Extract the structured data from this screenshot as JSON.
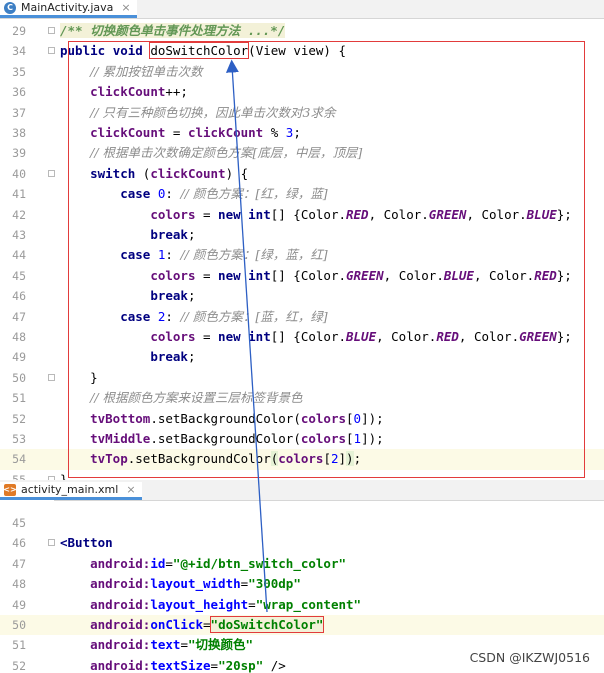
{
  "tabs": {
    "java_file": "MainActivity.java",
    "xml_file": "activity_main.xml"
  },
  "editor1": {
    "lines": [
      {
        "n": "29",
        "parts": [
          [
            "doc",
            "/** 切换颜色单击事件处理方法 ...*/"
          ]
        ]
      },
      {
        "n": "34",
        "parts": [
          [
            "kw",
            "public "
          ],
          [
            "kw",
            "void "
          ],
          [
            "box",
            "doSwitchColor"
          ],
          [
            "pl",
            "(View view) {"
          ]
        ]
      },
      {
        "n": "35",
        "parts": [
          [
            "pl",
            "    "
          ],
          [
            "cm",
            "// 累加按钮单击次数"
          ]
        ]
      },
      {
        "n": "36",
        "parts": [
          [
            "pl",
            "    "
          ],
          [
            "fld",
            "clickCount"
          ],
          [
            "pl",
            "++;"
          ]
        ]
      },
      {
        "n": "37",
        "parts": [
          [
            "pl",
            "    "
          ],
          [
            "cm",
            "// 只有三种颜色切换，因此单击次数对3求余"
          ]
        ]
      },
      {
        "n": "38",
        "parts": [
          [
            "pl",
            "    "
          ],
          [
            "fld",
            "clickCount"
          ],
          [
            "pl",
            " = "
          ],
          [
            "fld",
            "clickCount"
          ],
          [
            "pl",
            " % "
          ],
          [
            "num",
            "3"
          ],
          [
            "pl",
            ";"
          ]
        ]
      },
      {
        "n": "39",
        "parts": [
          [
            "pl",
            "    "
          ],
          [
            "cm",
            "// 根据单击次数确定颜色方案[底层，中层，顶层]"
          ]
        ]
      },
      {
        "n": "40",
        "parts": [
          [
            "pl",
            "    "
          ],
          [
            "kw",
            "switch"
          ],
          [
            "pl",
            " ("
          ],
          [
            "fld",
            "clickCount"
          ],
          [
            "pl",
            ") {"
          ]
        ]
      },
      {
        "n": "41",
        "parts": [
          [
            "pl",
            "        "
          ],
          [
            "kw",
            "case "
          ],
          [
            "num",
            "0"
          ],
          [
            "pl",
            ": "
          ],
          [
            "cm",
            "// 颜色方案：[红，绿，蓝]"
          ]
        ]
      },
      {
        "n": "42",
        "parts": [
          [
            "pl",
            "            "
          ],
          [
            "fld",
            "colors"
          ],
          [
            "pl",
            " = "
          ],
          [
            "kw",
            "new "
          ],
          [
            "kw",
            "int"
          ],
          [
            "pl",
            "[] {Color."
          ],
          [
            "cst",
            "RED"
          ],
          [
            "pl",
            ", Color."
          ],
          [
            "cst",
            "GREEN"
          ],
          [
            "pl",
            ", Color."
          ],
          [
            "cst",
            "BLUE"
          ],
          [
            "pl",
            "};"
          ]
        ]
      },
      {
        "n": "43",
        "parts": [
          [
            "pl",
            "            "
          ],
          [
            "kw",
            "break"
          ],
          [
            "pl",
            ";"
          ]
        ]
      },
      {
        "n": "44",
        "parts": [
          [
            "pl",
            "        "
          ],
          [
            "kw",
            "case "
          ],
          [
            "num",
            "1"
          ],
          [
            "pl",
            ": "
          ],
          [
            "cm",
            "// 颜色方案：[绿，蓝，红]"
          ]
        ]
      },
      {
        "n": "45",
        "parts": [
          [
            "pl",
            "            "
          ],
          [
            "fld",
            "colors"
          ],
          [
            "pl",
            " = "
          ],
          [
            "kw",
            "new "
          ],
          [
            "kw",
            "int"
          ],
          [
            "pl",
            "[] {Color."
          ],
          [
            "cst",
            "GREEN"
          ],
          [
            "pl",
            ", Color."
          ],
          [
            "cst",
            "BLUE"
          ],
          [
            "pl",
            ", Color."
          ],
          [
            "cst",
            "RED"
          ],
          [
            "pl",
            "};"
          ]
        ]
      },
      {
        "n": "46",
        "parts": [
          [
            "pl",
            "            "
          ],
          [
            "kw",
            "break"
          ],
          [
            "pl",
            ";"
          ]
        ]
      },
      {
        "n": "47",
        "parts": [
          [
            "pl",
            "        "
          ],
          [
            "kw",
            "case "
          ],
          [
            "num",
            "2"
          ],
          [
            "pl",
            ": "
          ],
          [
            "cm",
            "// 颜色方案：[蓝，红，绿]"
          ]
        ]
      },
      {
        "n": "48",
        "parts": [
          [
            "pl",
            "            "
          ],
          [
            "fld",
            "colors"
          ],
          [
            "pl",
            " = "
          ],
          [
            "kw",
            "new "
          ],
          [
            "kw",
            "int"
          ],
          [
            "pl",
            "[] {Color."
          ],
          [
            "cst",
            "BLUE"
          ],
          [
            "pl",
            ", Color."
          ],
          [
            "cst",
            "RED"
          ],
          [
            "pl",
            ", Color."
          ],
          [
            "cst",
            "GREEN"
          ],
          [
            "pl",
            "};"
          ]
        ]
      },
      {
        "n": "49",
        "parts": [
          [
            "pl",
            "            "
          ],
          [
            "kw",
            "break"
          ],
          [
            "pl",
            ";"
          ]
        ]
      },
      {
        "n": "50",
        "parts": [
          [
            "pl",
            "    }"
          ]
        ]
      },
      {
        "n": "51",
        "parts": [
          [
            "pl",
            "    "
          ],
          [
            "cm",
            "// 根据颜色方案来设置三层标签背景色"
          ]
        ]
      },
      {
        "n": "52",
        "parts": [
          [
            "pl",
            "    "
          ],
          [
            "fld",
            "tvBottom"
          ],
          [
            "pl",
            ".setBackgroundColor("
          ],
          [
            "fld",
            "colors"
          ],
          [
            "pl",
            "["
          ],
          [
            "num",
            "0"
          ],
          [
            "pl",
            "]);"
          ]
        ]
      },
      {
        "n": "53",
        "parts": [
          [
            "pl",
            "    "
          ],
          [
            "fld",
            "tvMiddle"
          ],
          [
            "pl",
            ".setBackgroundColor("
          ],
          [
            "fld",
            "colors"
          ],
          [
            "pl",
            "["
          ],
          [
            "num",
            "1"
          ],
          [
            "pl",
            "]);"
          ]
        ]
      },
      {
        "n": "54",
        "current": true,
        "parts": [
          [
            "pl",
            "    "
          ],
          [
            "fld",
            "tvTop"
          ],
          [
            "pl",
            ".setBackgroundColor"
          ],
          [
            "hl",
            "("
          ],
          [
            "fld",
            "colors"
          ],
          [
            "pl",
            "["
          ],
          [
            "num",
            "2"
          ],
          [
            "pl",
            "]"
          ],
          [
            "hl",
            ")"
          ],
          [
            "pl",
            ";"
          ]
        ]
      },
      {
        "n": "55",
        "parts": [
          [
            "pl",
            "}"
          ]
        ]
      }
    ]
  },
  "editor2": {
    "lines": [
      {
        "n": "45",
        "parts": []
      },
      {
        "n": "46",
        "parts": [
          [
            "tag",
            "<Button"
          ]
        ]
      },
      {
        "n": "47",
        "parts": [
          [
            "pl",
            "    "
          ],
          [
            "attrns",
            "android:"
          ],
          [
            "attr",
            "id"
          ],
          [
            "pl",
            "="
          ],
          [
            "str",
            "\"@+id/btn_switch_color\""
          ]
        ]
      },
      {
        "n": "48",
        "parts": [
          [
            "pl",
            "    "
          ],
          [
            "attrns",
            "android:"
          ],
          [
            "attr",
            "layout_width"
          ],
          [
            "pl",
            "="
          ],
          [
            "str",
            "\"300dp\""
          ]
        ]
      },
      {
        "n": "49",
        "parts": [
          [
            "pl",
            "    "
          ],
          [
            "attrns",
            "android:"
          ],
          [
            "attr",
            "layout_height"
          ],
          [
            "pl",
            "="
          ],
          [
            "str",
            "\"wrap_content\""
          ]
        ]
      },
      {
        "n": "50",
        "current": true,
        "parts": [
          [
            "pl",
            "    "
          ],
          [
            "attrns",
            "android:"
          ],
          [
            "attr",
            "onClick"
          ],
          [
            "pl",
            "="
          ],
          [
            "strbox",
            "\"doSwitchColor\""
          ]
        ]
      },
      {
        "n": "51",
        "parts": [
          [
            "pl",
            "    "
          ],
          [
            "attrns",
            "android:"
          ],
          [
            "attr",
            "text"
          ],
          [
            "pl",
            "="
          ],
          [
            "str",
            "\"切换颜色\""
          ]
        ]
      },
      {
        "n": "52",
        "parts": [
          [
            "pl",
            "    "
          ],
          [
            "attrns",
            "android:"
          ],
          [
            "attr",
            "textSize"
          ],
          [
            "pl",
            "="
          ],
          [
            "str",
            "\"20sp\""
          ],
          [
            "pl",
            " />"
          ]
        ]
      }
    ]
  },
  "watermark": "CSDN @IKZWJ0516",
  "colors": {
    "annotation_red": "#e23b3b",
    "arrow_blue": "#2d5fc4",
    "current_line": "#fcfae6"
  }
}
